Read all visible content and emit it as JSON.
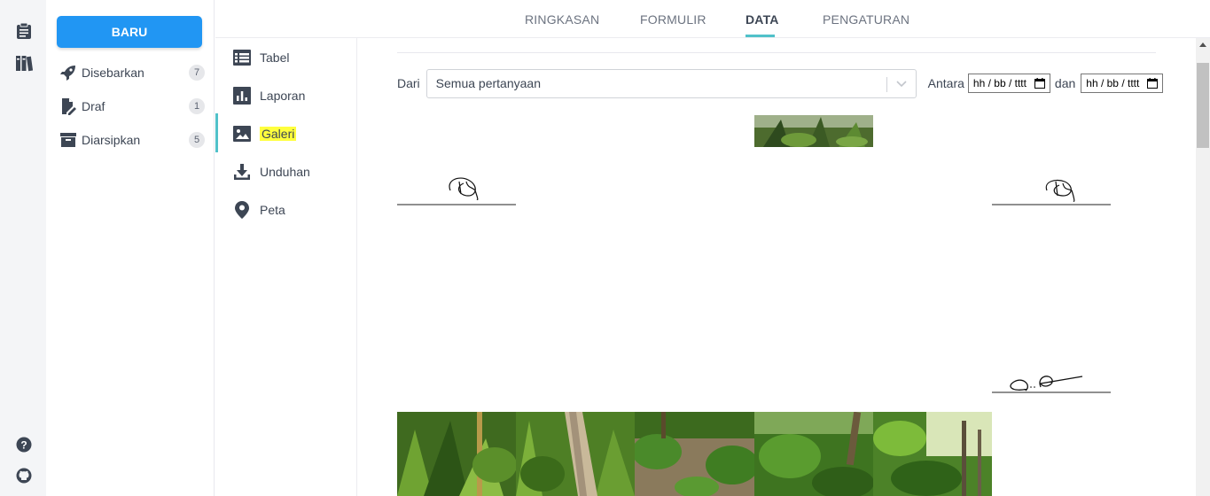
{
  "drawer": {
    "new_label": "BARU",
    "items": [
      {
        "label": "Disebarkan",
        "count": "7",
        "icon": "rocket-icon"
      },
      {
        "label": "Draf",
        "count": "1",
        "icon": "draft-edit-icon"
      },
      {
        "label": "Diarsipkan",
        "count": "5",
        "icon": "archive-icon"
      }
    ]
  },
  "tabs": [
    {
      "label": "RINGKASAN"
    },
    {
      "label": "FORMULIR"
    },
    {
      "label": "DATA",
      "active": true
    },
    {
      "label": "PENGATURAN"
    }
  ],
  "subnav": [
    {
      "label": "Tabel",
      "icon": "table-icon"
    },
    {
      "label": "Laporan",
      "icon": "bar-chart-icon"
    },
    {
      "label": "Galeri",
      "icon": "gallery-icon",
      "active": true
    },
    {
      "label": "Unduhan",
      "icon": "download-icon"
    },
    {
      "label": "Peta",
      "icon": "map-pin-icon"
    }
  ],
  "filter": {
    "from_label": "Dari",
    "question_select": "Semua pertanyaan",
    "between_label": "Antara",
    "date_start": "hh / bb / tttt",
    "and_label": "dan",
    "date_end": "hh / bb / tttt"
  },
  "colors": {
    "accent": "#2196f3",
    "active_tab": "#50c1c9",
    "highlight": "#ffff3d"
  }
}
